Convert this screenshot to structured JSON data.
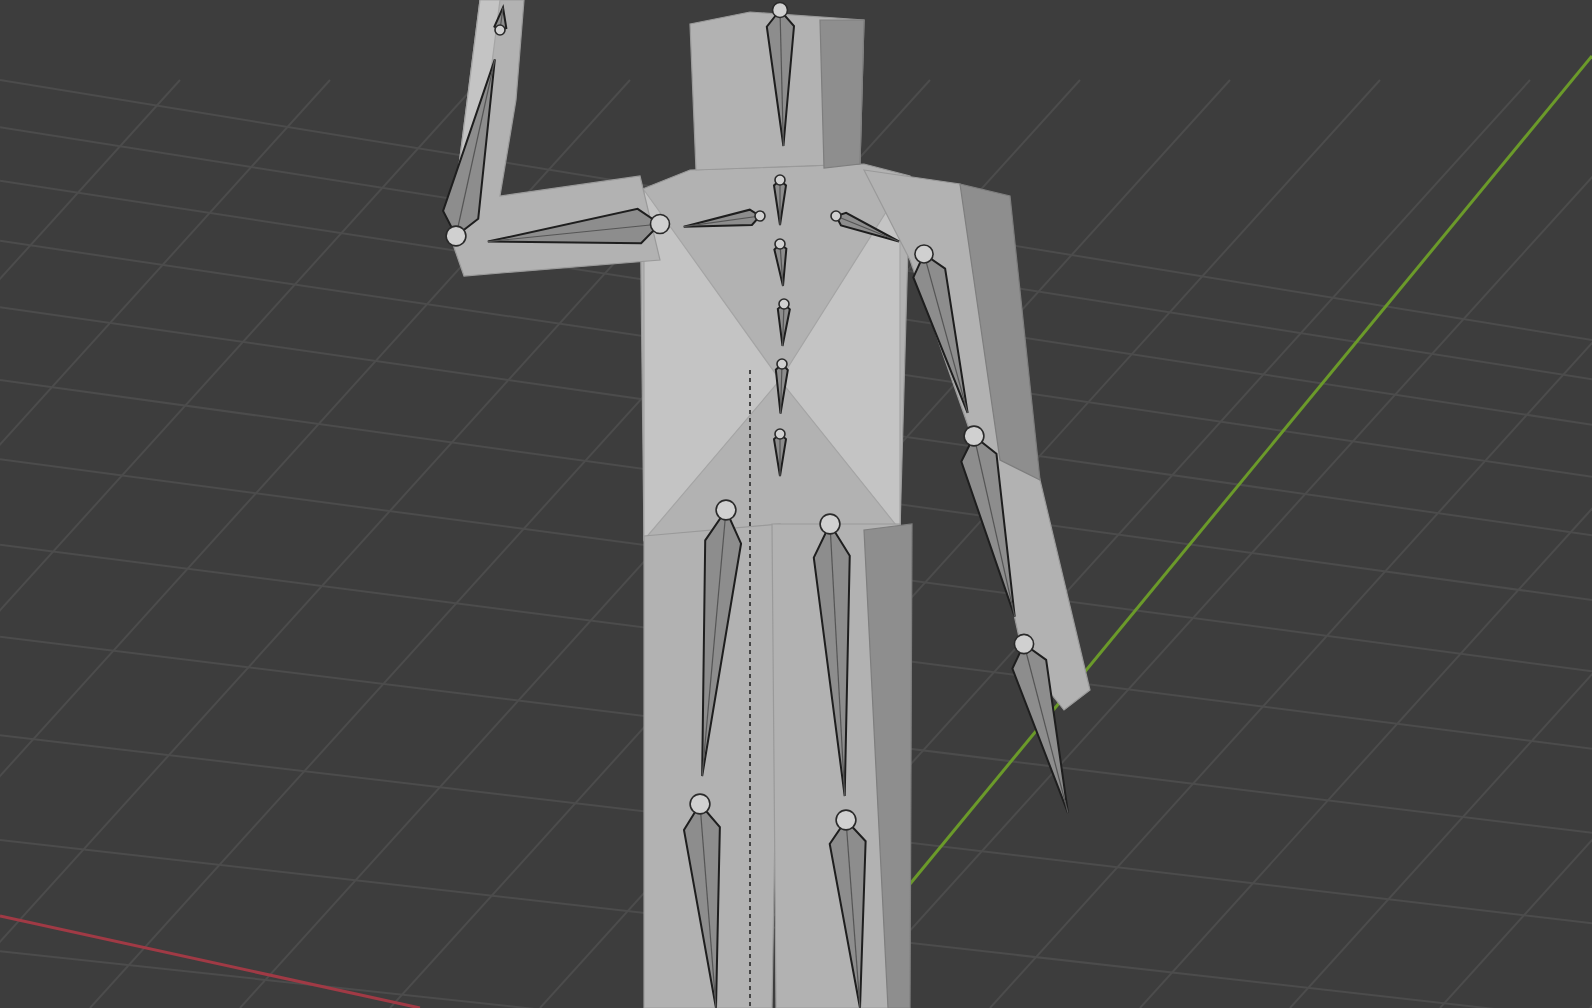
{
  "viewport": {
    "show_grid": true,
    "show_axes": true,
    "show_armature": true
  }
}
